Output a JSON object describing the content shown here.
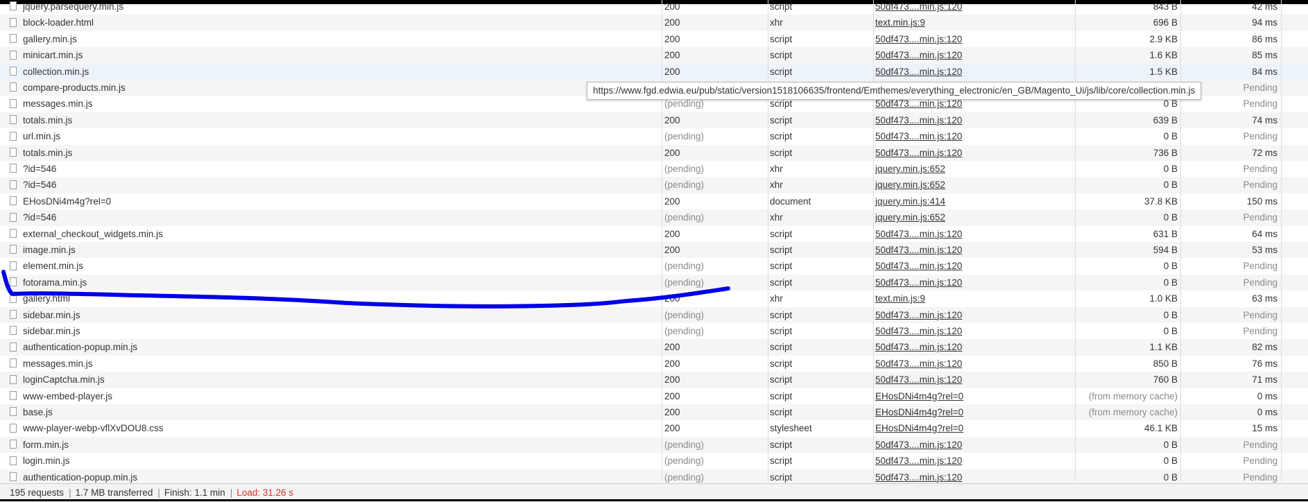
{
  "requests": [
    {
      "name": "jquery.parsequery.min.js",
      "status": "200",
      "type": "script",
      "initiator": "50df473....min.js:120",
      "size": "843 B",
      "time": "42 ms"
    },
    {
      "name": "block-loader.html",
      "status": "200",
      "type": "xhr",
      "initiator": "text.min.js:9",
      "size": "696 B",
      "time": "94 ms"
    },
    {
      "name": "gallery.min.js",
      "status": "200",
      "type": "script",
      "initiator": "50df473....min.js:120",
      "size": "2.9 KB",
      "time": "86 ms"
    },
    {
      "name": "minicart.min.js",
      "status": "200",
      "type": "script",
      "initiator": "50df473....min.js:120",
      "size": "1.6 KB",
      "time": "85 ms"
    },
    {
      "name": "collection.min.js",
      "status": "200",
      "type": "script",
      "initiator": "50df473....min.js:120",
      "size": "1.5 KB",
      "time": "84 ms"
    },
    {
      "name": "compare-products.min.js",
      "status": "",
      "type": "",
      "initiator": "",
      "size": "",
      "time": "Pending"
    },
    {
      "name": "messages.min.js",
      "status": "(pending)",
      "type": "script",
      "initiator": "50df473....min.js:120",
      "size": "0 B",
      "time": "Pending"
    },
    {
      "name": "totals.min.js",
      "status": "200",
      "type": "script",
      "initiator": "50df473....min.js:120",
      "size": "639 B",
      "time": "74 ms"
    },
    {
      "name": "url.min.js",
      "status": "(pending)",
      "type": "script",
      "initiator": "50df473....min.js:120",
      "size": "0 B",
      "time": "Pending"
    },
    {
      "name": "totals.min.js",
      "status": "200",
      "type": "script",
      "initiator": "50df473....min.js:120",
      "size": "736 B",
      "time": "72 ms"
    },
    {
      "name": "?id=546",
      "status": "(pending)",
      "type": "xhr",
      "initiator": "jquery.min.js:652",
      "size": "0 B",
      "time": "Pending"
    },
    {
      "name": "?id=546",
      "status": "(pending)",
      "type": "xhr",
      "initiator": "jquery.min.js:652",
      "size": "0 B",
      "time": "Pending"
    },
    {
      "name": "EHosDNi4m4g?rel=0",
      "status": "200",
      "type": "document",
      "initiator": "jquery.min.js:414",
      "size": "37.8 KB",
      "time": "150 ms"
    },
    {
      "name": "?id=546",
      "status": "(pending)",
      "type": "xhr",
      "initiator": "jquery.min.js:652",
      "size": "0 B",
      "time": "Pending"
    },
    {
      "name": "external_checkout_widgets.min.js",
      "status": "200",
      "type": "script",
      "initiator": "50df473....min.js:120",
      "size": "631 B",
      "time": "64 ms"
    },
    {
      "name": "image.min.js",
      "status": "200",
      "type": "script",
      "initiator": "50df473....min.js:120",
      "size": "594 B",
      "time": "53 ms"
    },
    {
      "name": "element.min.js",
      "status": "(pending)",
      "type": "script",
      "initiator": "50df473....min.js:120",
      "size": "0 B",
      "time": "Pending"
    },
    {
      "name": "fotorama.min.js",
      "status": "(pending)",
      "type": "script",
      "initiator": "50df473....min.js:120",
      "size": "0 B",
      "time": "Pending"
    },
    {
      "name": "gallery.html",
      "status": "200",
      "type": "xhr",
      "initiator": "text.min.js:9",
      "size": "1.0 KB",
      "time": "63 ms"
    },
    {
      "name": "sidebar.min.js",
      "status": "(pending)",
      "type": "script",
      "initiator": "50df473....min.js:120",
      "size": "0 B",
      "time": "Pending"
    },
    {
      "name": "sidebar.min.js",
      "status": "(pending)",
      "type": "script",
      "initiator": "50df473....min.js:120",
      "size": "0 B",
      "time": "Pending"
    },
    {
      "name": "authentication-popup.min.js",
      "status": "200",
      "type": "script",
      "initiator": "50df473....min.js:120",
      "size": "1.1 KB",
      "time": "82 ms"
    },
    {
      "name": "messages.min.js",
      "status": "200",
      "type": "script",
      "initiator": "50df473....min.js:120",
      "size": "850 B",
      "time": "76 ms"
    },
    {
      "name": "loginCaptcha.min.js",
      "status": "200",
      "type": "script",
      "initiator": "50df473....min.js:120",
      "size": "760 B",
      "time": "71 ms"
    },
    {
      "name": "www-embed-player.js",
      "status": "200",
      "type": "script",
      "initiator": "EHosDNi4m4g?rel=0",
      "size": "(from memory cache)",
      "time": "0 ms"
    },
    {
      "name": "base.js",
      "status": "200",
      "type": "script",
      "initiator": "EHosDNi4m4g?rel=0",
      "size": "(from memory cache)",
      "time": "0 ms"
    },
    {
      "name": "www-player-webp-vflXvDOU8.css",
      "status": "200",
      "type": "stylesheet",
      "initiator": "EHosDNi4m4g?rel=0",
      "size": "46.1 KB",
      "time": "15 ms"
    },
    {
      "name": "form.min.js",
      "status": "(pending)",
      "type": "script",
      "initiator": "50df473....min.js:120",
      "size": "0 B",
      "time": "Pending"
    },
    {
      "name": "login.min.js",
      "status": "(pending)",
      "type": "script",
      "initiator": "50df473....min.js:120",
      "size": "0 B",
      "time": "Pending"
    },
    {
      "name": "authentication-popup.min.js",
      "status": "(pending)",
      "type": "script",
      "initiator": "50df473....min.js:120",
      "size": "0 B",
      "time": "Pending"
    }
  ],
  "tooltip": "https://www.fgd.edwia.eu/pub/static/version1518106635/frontend/Emthemes/everything_electronic/en_GB/Magento_Ui/js/lib/core/collection.min.js",
  "status_bar": {
    "requests": "195 requests",
    "transferred": "1.7 MB transferred",
    "finish": "Finish: 1.1 min",
    "load": "Load: 31.26 s"
  },
  "colors": {
    "annotation_stroke": "#0000e6",
    "load_text": "#d93025"
  }
}
